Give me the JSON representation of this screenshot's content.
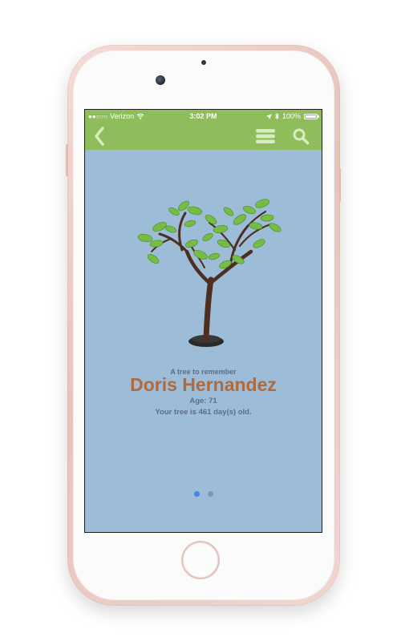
{
  "status_bar": {
    "signal_dots": "●●○○○",
    "carrier": "Verizon",
    "time": "3:02 PM",
    "battery_text": "100%",
    "battery_level": 1.0
  },
  "nav": {
    "back_icon": "chevron-left-icon",
    "menu_icon": "hamburger-menu-icon",
    "search_icon": "search-icon"
  },
  "memorial": {
    "subtitle": "A tree to remember",
    "name": "Doris Hernandez",
    "age": "Age: 71",
    "tree_age": "Your tree is 461 day(s) old."
  },
  "pager": {
    "total": 2,
    "active": 1
  },
  "colors": {
    "header": "#8fbd5c",
    "background": "#9cbcd7",
    "name": "#b06a3d",
    "text": "#5a6e88",
    "active_dot": "#3d87e8"
  }
}
